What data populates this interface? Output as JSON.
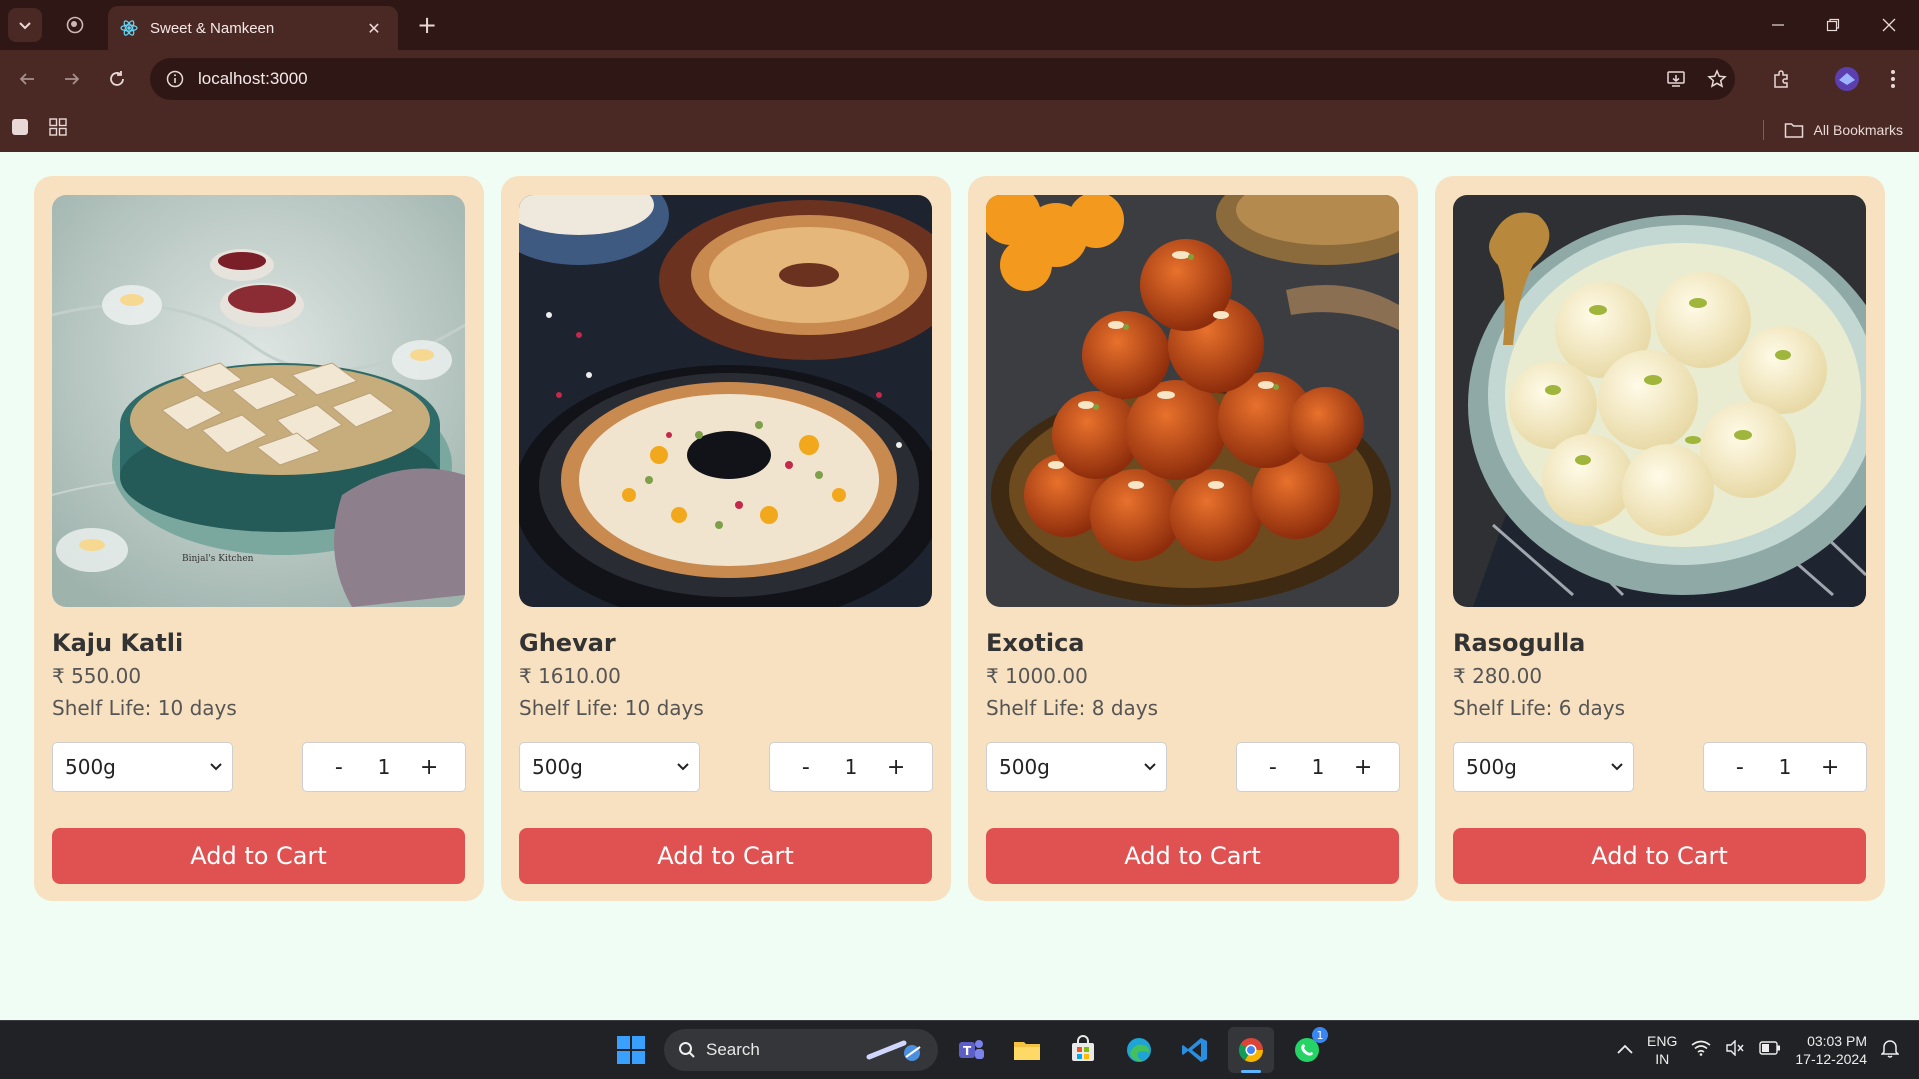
{
  "browser": {
    "tab_title": "Sweet & Namkeen",
    "tab_close": "✕",
    "new_tab": "+",
    "url": "localhost:3000",
    "bookmarks_label": "All Bookmarks"
  },
  "products": [
    {
      "name": "Kaju Katli",
      "price": "₹ 550.00",
      "shelf": "Shelf Life: 10 days",
      "size": "500g",
      "qty": "1",
      "minus": "-",
      "plus": "+",
      "cta": "Add to Cart"
    },
    {
      "name": "Ghevar",
      "price": "₹ 1610.00",
      "shelf": "Shelf Life: 10 days",
      "size": "500g",
      "qty": "1",
      "minus": "-",
      "plus": "+",
      "cta": "Add to Cart"
    },
    {
      "name": "Exotica",
      "price": "₹ 1000.00",
      "shelf": "Shelf Life: 8 days",
      "size": "500g",
      "qty": "1",
      "minus": "-",
      "plus": "+",
      "cta": "Add to Cart"
    },
    {
      "name": "Rasogulla",
      "price": "₹ 280.00",
      "shelf": "Shelf Life: 6 days",
      "size": "500g",
      "qty": "1",
      "minus": "-",
      "plus": "+",
      "cta": "Add to Cart"
    }
  ],
  "taskbar": {
    "search_label": "Search",
    "lang_line1": "ENG",
    "lang_line2": "IN",
    "time": "03:03 PM",
    "date": "17-12-2024",
    "whatsapp_badge": "1"
  },
  "colors": {
    "card_bg": "#f8e1c0",
    "button_red": "#e05252",
    "page_bg": "#f0fdf4",
    "chrome_dark": "#2e1714",
    "chrome_mid": "#4a2824"
  }
}
